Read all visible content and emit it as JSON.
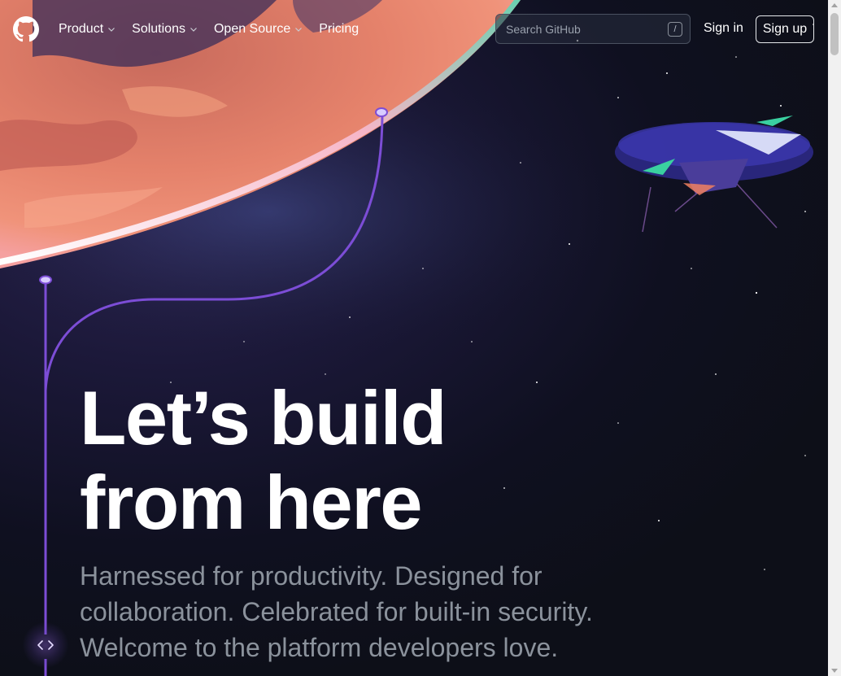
{
  "header": {
    "nav": [
      {
        "label": "Product",
        "has_dropdown": true
      },
      {
        "label": "Solutions",
        "has_dropdown": true
      },
      {
        "label": "Open Source",
        "has_dropdown": true
      },
      {
        "label": "Pricing",
        "has_dropdown": false
      }
    ],
    "search": {
      "placeholder": "Search GitHub",
      "shortcut": "/"
    },
    "signin_label": "Sign in",
    "signup_label": "Sign up"
  },
  "hero": {
    "headline_line1": "Let’s build",
    "headline_line2": "from here",
    "subhead_line1": "Harnessed for productivity. Designed for",
    "subhead_line2": "collaboration. Celebrated for built-in security.",
    "subhead_line3": "Welcome to the platform developers love."
  },
  "icons": {
    "logo": "github-octocat-icon",
    "code": "code-icon",
    "chevron": "chevron-down-icon"
  },
  "colors": {
    "background": "#0d1117",
    "accent_line": "#7c4dd6",
    "planet": "#e9836a",
    "subhead": "#8b929c"
  }
}
